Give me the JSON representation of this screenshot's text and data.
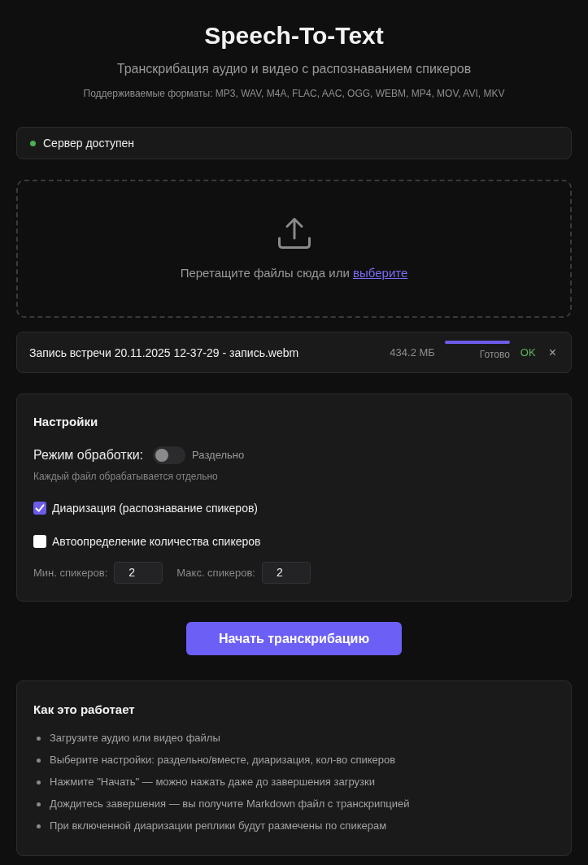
{
  "header": {
    "title": "Speech-To-Text",
    "subtitle": "Транскрибация аудио и видео с распознаванием спикеров",
    "formats": "Поддерживаемые форматы: MP3, WAV, M4A, FLAC, AAC, OGG, WEBM, MP4, MOV, AVI, MKV"
  },
  "server_status": {
    "text": "Сервер доступен",
    "available": true
  },
  "dropzone": {
    "text": "Перетащите файлы сюда или",
    "link": "выберите"
  },
  "files": [
    {
      "name": "Запись встречи 20.11.2025 12-37-29 - запись.webm",
      "size": "434.2 МБ",
      "level": 1,
      "status": "Готово",
      "result": "OK",
      "remove": "×"
    }
  ],
  "settings": {
    "title": "Настройки",
    "mode": {
      "label": "Режим обработки:",
      "on": false,
      "value": "Раздельно",
      "hint": "Каждый файл обрабатывается отдельно"
    },
    "options": [
      {
        "label": "Диаризация (распознавание спикеров)",
        "checked": true
      },
      {
        "label": "Автоопределение количества спикеров",
        "checked": false
      }
    ],
    "speakers": [
      {
        "label": "Мин. спикеров:",
        "value": "2"
      },
      {
        "label": "Макс. спикеров:",
        "value": "2"
      }
    ]
  },
  "start_button": "Начать транскрибацию",
  "how_it_works": {
    "title": "Как это работает",
    "steps": [
      "Загрузите аудио или видео файлы",
      "Выберите настройки: раздельно/вместе, диаризация, кол-во спикеров",
      "Нажмите \"Начать\" — можно нажать даже до завершения загрузки",
      "Дождитесь завершения — вы получите Markdown файл с транскрипцией",
      "При включенной диаризации реплики будут размечены по спикерам"
    ]
  }
}
